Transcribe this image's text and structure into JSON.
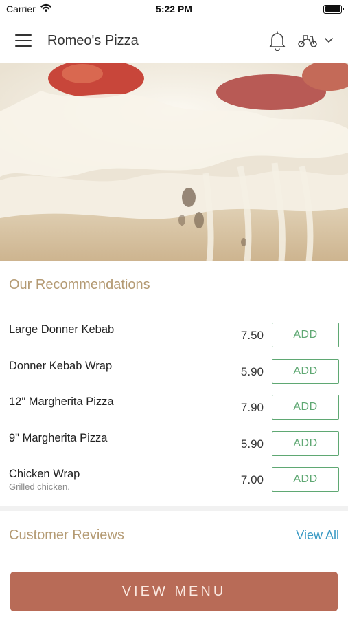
{
  "status_bar": {
    "carrier": "Carrier",
    "time": "5:22 PM"
  },
  "header": {
    "title": "Romeo's Pizza",
    "icons": [
      "menu-icon",
      "bell-icon",
      "scooter-icon",
      "chevron-down-icon"
    ]
  },
  "recommendations": {
    "title": "Our Recommendations",
    "items": [
      {
        "name": "Large Donner Kebab",
        "description": "",
        "price": "7.50",
        "button": "ADD"
      },
      {
        "name": "Donner Kebab Wrap",
        "description": "",
        "price": "5.90",
        "button": "ADD"
      },
      {
        "name": "12\" Margherita Pizza",
        "description": "",
        "price": "7.90",
        "button": "ADD"
      },
      {
        "name": "9\" Margherita Pizza",
        "description": "",
        "price": "5.90",
        "button": "ADD"
      },
      {
        "name": "Chicken Wrap",
        "description": "Grilled chicken.",
        "price": "7.00",
        "button": "ADD"
      }
    ]
  },
  "reviews": {
    "title": "Customer Reviews",
    "view_all": "View All"
  },
  "cta": {
    "label": "VIEW MENU"
  },
  "colors": {
    "accent_gold": "#b49a73",
    "add_green": "#5fa873",
    "link_blue": "#3a9ac4",
    "cta_bg": "#b86b57"
  }
}
